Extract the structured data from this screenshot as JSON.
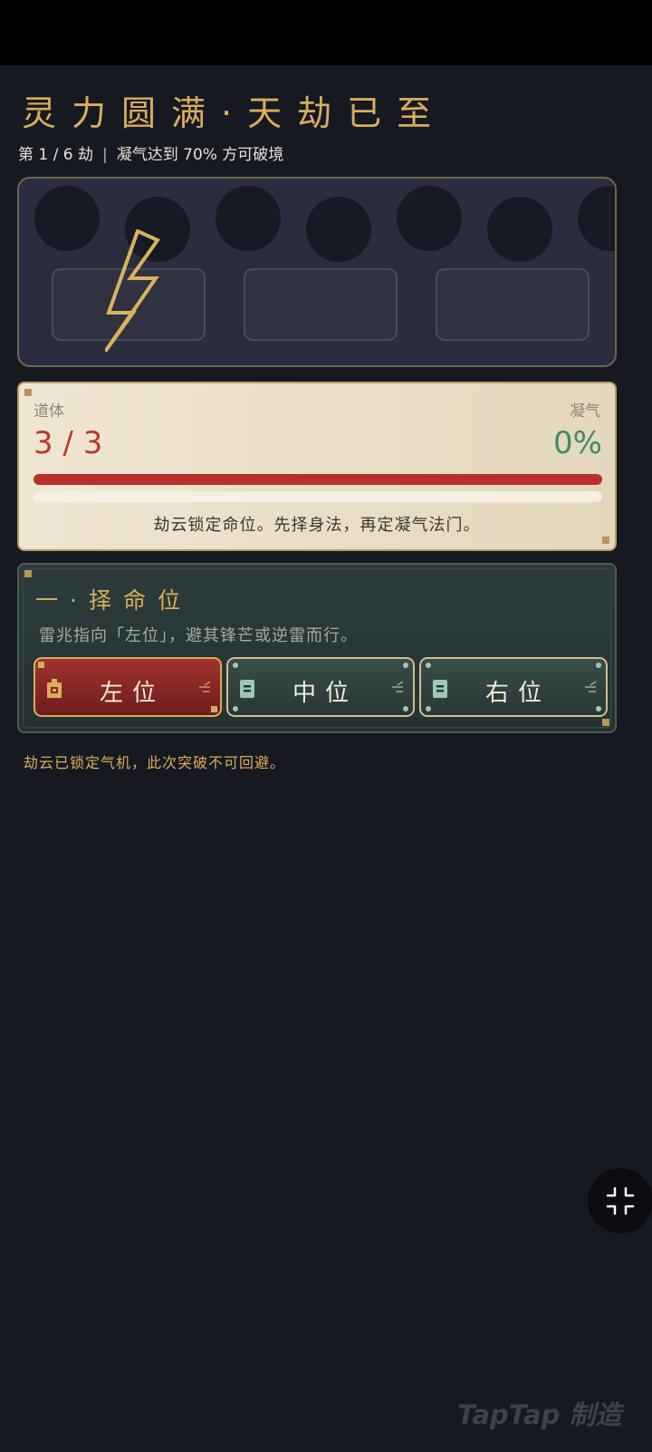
{
  "header": {
    "title": "灵力圆满·天劫已至",
    "round": "第 1 / 6 劫",
    "separator": "|",
    "condition": "凝气达到 70% 方可破境"
  },
  "status": {
    "body_label": "道体",
    "body_value": "3 / 3",
    "qi_label": "凝气",
    "qi_value": "0%",
    "qi_progress": 0,
    "body_progress": 1,
    "message": "劫云锁定命位。先择身法，再定凝气法门。"
  },
  "choice": {
    "heading": "一·择命位",
    "hint": "雷兆指向「左位」，避其锋芒或逆雷而行。",
    "options": [
      {
        "label": "左位",
        "selected": true
      },
      {
        "label": "中位",
        "selected": false
      },
      {
        "label": "右位",
        "selected": false
      }
    ]
  },
  "note": "劫云已锁定气机，此次突破不可回避。",
  "watermark": "TapTap 制造",
  "icons": {
    "lightning": "lightning-bolt-icon",
    "fullscreen": "exit-fullscreen-icon",
    "option": "talisman-icon",
    "wave": "qi-wave-icon"
  },
  "colors": {
    "gold": "#d9ad5a",
    "hp_red": "#b83a2c",
    "qi_green": "#3f8c68",
    "selected_option": "#a1332c"
  }
}
